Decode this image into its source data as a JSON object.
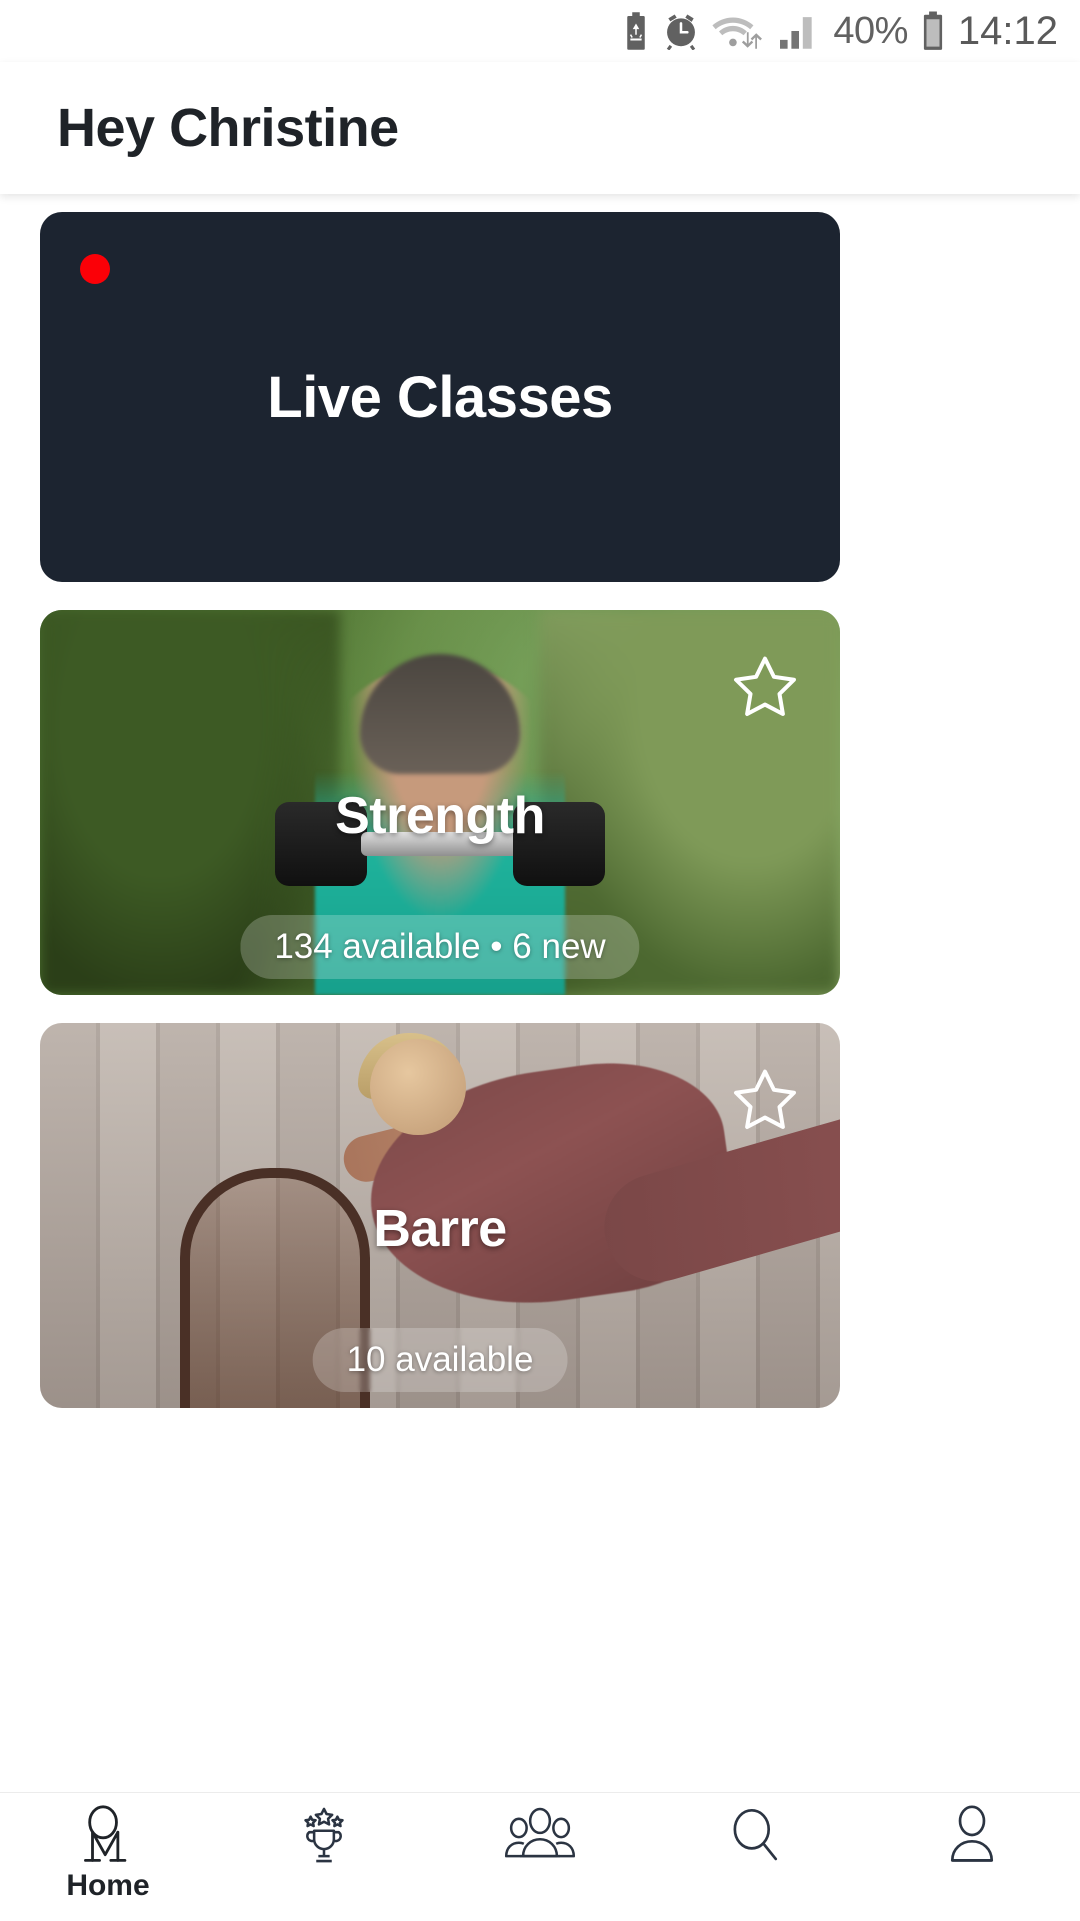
{
  "status_bar": {
    "icons": [
      "power-saving-battery-icon",
      "alarm-clock-icon",
      "wifi-icon",
      "cellular-signal-icon",
      "battery-icon"
    ],
    "battery_percent": "40%",
    "time": "14:12"
  },
  "header": {
    "greeting": "Hey Christine"
  },
  "cards": [
    {
      "type": "live",
      "title": "Live Classes",
      "live_indicator": "live-dot",
      "badge": "",
      "favorite": false
    },
    {
      "type": "category",
      "title": "Strength",
      "badge": "134 available • 6 new",
      "favorite": true,
      "favorite_icon": "star-outline-icon"
    },
    {
      "type": "category",
      "title": "Barre",
      "badge": "10 available",
      "favorite": true,
      "favorite_icon": "star-outline-icon"
    }
  ],
  "bottom_nav": {
    "items": [
      {
        "label": "Home",
        "icon": "om-monogram-icon",
        "active": true
      },
      {
        "label": "",
        "icon": "trophy-icon",
        "active": false
      },
      {
        "label": "",
        "icon": "people-group-icon",
        "active": false
      },
      {
        "label": "",
        "icon": "search-icon",
        "active": false
      },
      {
        "label": "",
        "icon": "person-icon",
        "active": false
      }
    ]
  },
  "colors": {
    "live_card_bg": "#1c2430",
    "live_dot": "#fb0007",
    "text_dark": "#1f2328",
    "status_gray": "#616161",
    "page_bg": "#ffffff"
  }
}
